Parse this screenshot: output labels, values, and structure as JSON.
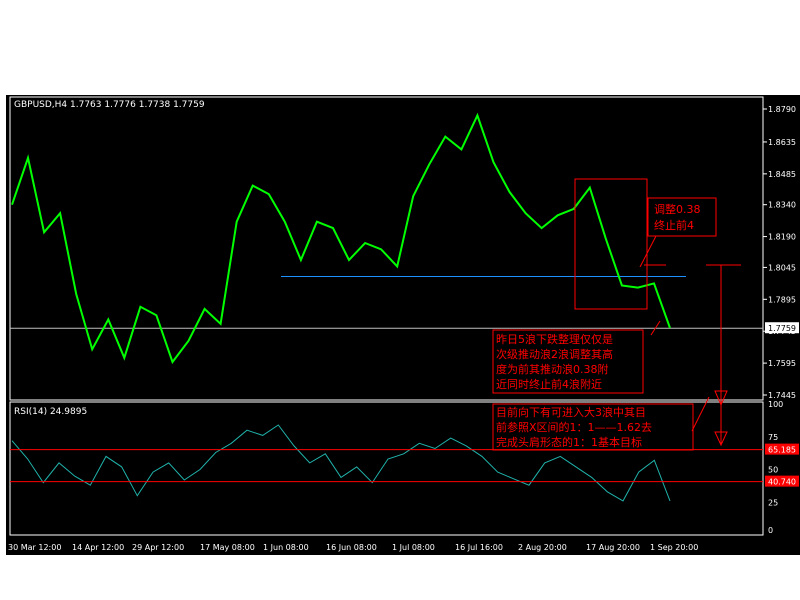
{
  "price_panel": {
    "header": "GBPUSD,H4  1.7763  1.7776  1.7738  1.7759",
    "current_price_label": "1.7759"
  },
  "rsi_panel": {
    "header": "RSI(14)  24.9895",
    "level_upper_label": "65.185",
    "level_lower_label": "40.740"
  },
  "annotations": {
    "box_note": [
      "调整0.38",
      "终止前4"
    ],
    "main_note": [
      "昨日5浪下跌整理仅仅是",
      "次级推动浪2浪调整其高",
      "度为前其推动浪0.38附",
      "近同时终止前4浪附近"
    ],
    "target_note": [
      "目前向下有可进入大3浪中其目",
      "前参照X区间的1：1——1.62去",
      "完成头肩形态的1：1基本目标"
    ]
  },
  "colors": {
    "background": "#000000",
    "price_series": "#00ff00",
    "rsi_series": "#20b2aa",
    "support_line": "#1e90ff",
    "annotation": "#ff0000",
    "axis": "#ffffff"
  },
  "chart_data": [
    {
      "type": "line",
      "title": "GBPUSD,H4",
      "series": [
        {
          "name": "GBPUSD",
          "x": [
            "30 Mar 12:00",
            "3 Apr",
            "6 Apr",
            "9 Apr",
            "14 Apr 12:00",
            "18 Apr",
            "21 Apr",
            "25 Apr",
            "29 Apr 12:00",
            "3 May",
            "7 May",
            "11 May",
            "14 May",
            "17 May 08:00",
            "20 May",
            "24 May",
            "28 May",
            "1 Jun 08:00",
            "5 Jun",
            "9 Jun",
            "12 Jun",
            "16 Jun 08:00",
            "19 Jun",
            "23 Jun",
            "27 Jun",
            "1 Jul 08:00",
            "5 Jul",
            "9 Jul",
            "12 Jul",
            "16 Jul 16:00",
            "20 Jul",
            "24 Jul",
            "28 Jul",
            "2 Aug 20:00",
            "6 Aug",
            "10 Aug",
            "14 Aug",
            "17 Aug 20:00",
            "21 Aug",
            "25 Aug",
            "29 Aug",
            "1 Sep 20:00"
          ],
          "values": [
            1.834,
            1.856,
            1.821,
            1.83,
            1.792,
            1.766,
            1.78,
            1.762,
            1.786,
            1.782,
            1.76,
            1.77,
            1.785,
            1.778,
            1.826,
            1.843,
            1.839,
            1.826,
            1.808,
            1.826,
            1.823,
            1.808,
            1.816,
            1.813,
            1.805,
            1.838,
            1.853,
            1.866,
            1.86,
            1.876,
            1.854,
            1.84,
            1.83,
            1.823,
            1.829,
            1.832,
            1.842,
            1.818,
            1.796,
            1.795,
            1.797,
            1.776
          ]
        }
      ],
      "x_tick_labels": [
        "30 Mar 12:00",
        "14 Apr 12:00",
        "29 Apr 12:00",
        "17 May 08:00",
        "1 Jun 08:00",
        "16 Jun 08:00",
        "1 Jul 08:00",
        "16 Jul 16:00",
        "2 Aug 20:00",
        "17 Aug 20:00",
        "1 Sep 20:00"
      ],
      "y_tick_labels": [
        "1.8790",
        "1.8635",
        "1.8485",
        "1.8340",
        "1.8190",
        "1.8045",
        "1.7895",
        "1.7745",
        "1.7595",
        "1.7445"
      ],
      "ylim": [
        1.7445,
        1.879
      ],
      "horizontal_lines": [
        {
          "value": 1.8002,
          "label": ""
        },
        {
          "value": 1.7759,
          "label": "1.7759"
        }
      ],
      "grid": false
    },
    {
      "type": "line",
      "title": "RSI(14)",
      "series": [
        {
          "name": "RSI",
          "values": [
            72,
            58,
            40,
            55,
            45,
            38,
            60,
            52,
            30,
            48,
            55,
            42,
            50,
            63,
            70,
            80,
            76,
            84,
            68,
            55,
            62,
            44,
            52,
            40,
            58,
            62,
            70,
            66,
            74,
            68,
            60,
            48,
            43,
            38,
            55,
            60,
            52,
            44,
            33,
            26,
            48,
            57,
            26
          ]
        }
      ],
      "y_tick_labels": [
        "100",
        "75",
        "50",
        "25",
        "0"
      ],
      "ylim": [
        0,
        100
      ],
      "horizontal_lines": [
        {
          "value": 65.185,
          "label": "65.185"
        },
        {
          "value": 40.74,
          "label": "40.740"
        }
      ],
      "grid": false
    }
  ]
}
